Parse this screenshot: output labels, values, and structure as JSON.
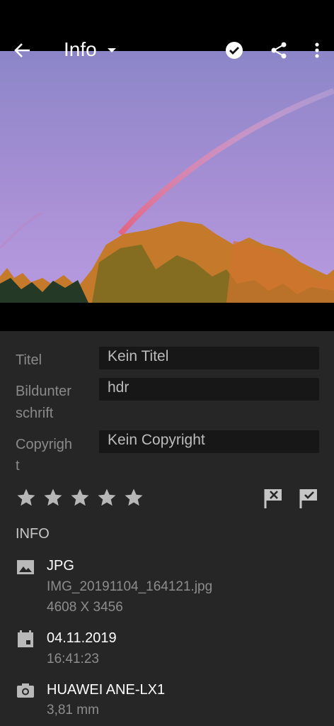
{
  "header": {
    "title": "Info",
    "back_icon": "arrow-left-icon",
    "check_icon": "check-circle-icon",
    "share_icon": "share-icon",
    "more_icon": "more-vertical-icon"
  },
  "metadata": {
    "title_label": "Titel",
    "title_value": "Kein Titel",
    "caption_label_line1": "Bildunter",
    "caption_label_line2": "schrift",
    "caption_value": "hdr",
    "copyright_label_line1": "Copyrigh",
    "copyright_label_line2": "t",
    "copyright_value": "Kein Copyright"
  },
  "rating": {
    "stars_total": 5,
    "stars_filled": 0,
    "reject_flag_icon": "flag-x-icon",
    "pick_flag_icon": "flag-check-icon"
  },
  "info": {
    "section_label": "INFO",
    "file_type": "JPG",
    "file_name": "IMG_20191104_164121.jpg",
    "dimensions": "4608 X 3456",
    "date": "04.11.2019",
    "time": "16:41:23",
    "camera": "HUAWEI ANE-LX1",
    "focal_length": "3,81 mm"
  },
  "colors": {
    "background": "#262626",
    "field_bg": "#171717",
    "label": "#8a8a8a"
  }
}
